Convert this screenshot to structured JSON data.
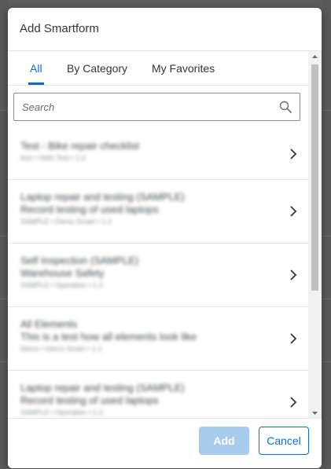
{
  "dialog": {
    "title": "Add Smartform",
    "tabs": [
      {
        "label": "All",
        "active": true
      },
      {
        "label": "By Category",
        "active": false
      },
      {
        "label": "My Favorites",
        "active": false
      }
    ],
    "search": {
      "placeholder": "Search",
      "value": ""
    },
    "items": [
      {
        "line1": "Test - Bike repair checklist",
        "line2": "",
        "meta": "test • Hello Test • 1.2"
      },
      {
        "line1": "Laptop repair and testing (SAMPLE)",
        "line2": "Record testing of used laptops",
        "meta": "SAMPLE • Demo Smart • 1.2"
      },
      {
        "line1": "Self Inspection (SAMPLE)",
        "line2": "Warehouse Safety",
        "meta": "SAMPLE • Operation • 1.2"
      },
      {
        "line1": "All Elements",
        "line2": "This is a test how all elements look like",
        "meta": "Demo • Demo Smart • 1.2"
      },
      {
        "line1": "Laptop repair and testing (SAMPLE)",
        "line2": "Record testing of used laptops",
        "meta": "SAMPLE • Operation • 1.2"
      }
    ],
    "footer": {
      "add_label": "Add",
      "cancel_label": "Cancel"
    }
  },
  "colors": {
    "accent": "#0a6ed1",
    "add_disabled": "#a8ccee",
    "overlay": "#5d5d5d"
  },
  "icons": {
    "search": "search-icon",
    "chevron": "chevron-right-icon"
  }
}
